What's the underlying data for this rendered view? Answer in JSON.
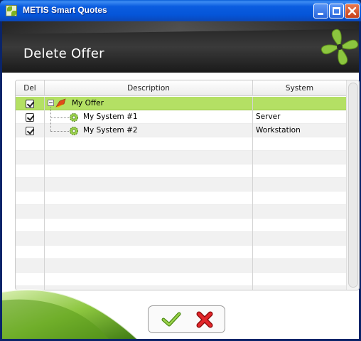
{
  "window": {
    "title": "METIS Smart Quotes"
  },
  "header": {
    "title": "Delete Offer"
  },
  "grid": {
    "columns": {
      "del": "Del",
      "description": "Description",
      "system": "System"
    },
    "rows": [
      {
        "checked": true,
        "description": "My Offer",
        "system": "",
        "kind": "offer",
        "selected": true
      },
      {
        "checked": true,
        "description": "My System #1",
        "system": "Server",
        "kind": "system"
      },
      {
        "checked": true,
        "description": "My System #2",
        "system": "Workstation",
        "kind": "system"
      }
    ]
  },
  "actions": {
    "ok_icon": "checkmark-icon",
    "cancel_icon": "x-icon"
  },
  "colors": {
    "accent_green": "#8cc63f",
    "selected_row": "#b4e064",
    "header_dark": "#2b2b2b",
    "cancel_red": "#d7141a"
  }
}
